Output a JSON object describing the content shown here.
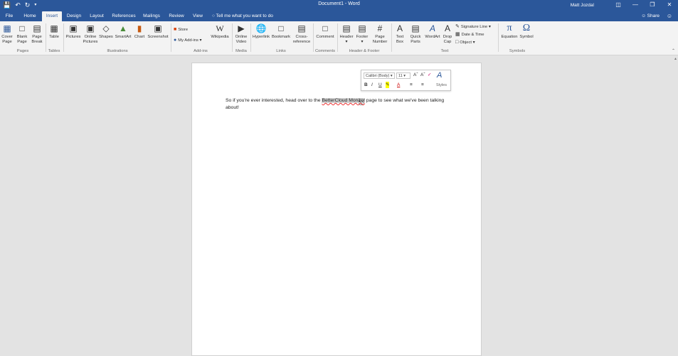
{
  "window": {
    "title": "Document1 - Word",
    "user": "Matt Jozdal",
    "share": "Share"
  },
  "tabs": [
    "File",
    "Home",
    "Insert",
    "Design",
    "Layout",
    "References",
    "Mailings",
    "Review",
    "View"
  ],
  "active_tab": "Insert",
  "tell_me": "Tell me what you want to do",
  "ribbon": {
    "pages": {
      "cover": "Cover\nPage",
      "blank": "Blank\nPage",
      "break": "Page\nBreak",
      "label": "Pages"
    },
    "tables": {
      "table": "Table",
      "label": "Tables"
    },
    "illustrations": {
      "pictures": "Pictures",
      "online": "Online\nPictures",
      "shapes": "Shapes",
      "smartart": "SmartArt",
      "chart": "Chart",
      "screenshot": "Screenshot",
      "label": "Illustrations"
    },
    "addins": {
      "store": "Store",
      "my_addins": "My Add-ins",
      "wikipedia": "Wikipedia",
      "label": "Add-ins"
    },
    "media": {
      "video": "Online\nVideo",
      "label": "Media"
    },
    "links": {
      "hyperlink": "Hyperlink",
      "bookmark": "Bookmark",
      "crossref": "Cross-\nreference",
      "label": "Links"
    },
    "comments": {
      "comment": "Comment",
      "label": "Comments"
    },
    "headerfooter": {
      "header": "Header",
      "footer": "Footer",
      "pagenum": "Page\nNumber",
      "label": "Header & Footer"
    },
    "text": {
      "textbox": "Text\nBox",
      "quickparts": "Quick\nParts",
      "wordart": "WordArt",
      "dropcap": "Drop\nCap",
      "signature": "Signature Line",
      "datetime": "Date & Time",
      "object": "Object",
      "label": "Text"
    },
    "symbols": {
      "equation": "Equation",
      "symbol": "Symbol",
      "label": "Symbols"
    }
  },
  "mini_toolbar": {
    "font": "Calibri (Body)",
    "size": "11",
    "styles": "Styles"
  },
  "document": {
    "before": "So if you're ever interested, head over to the ",
    "highlighted": "BetterCloud Monitor",
    "after": " page to see what we've been talking about!"
  }
}
